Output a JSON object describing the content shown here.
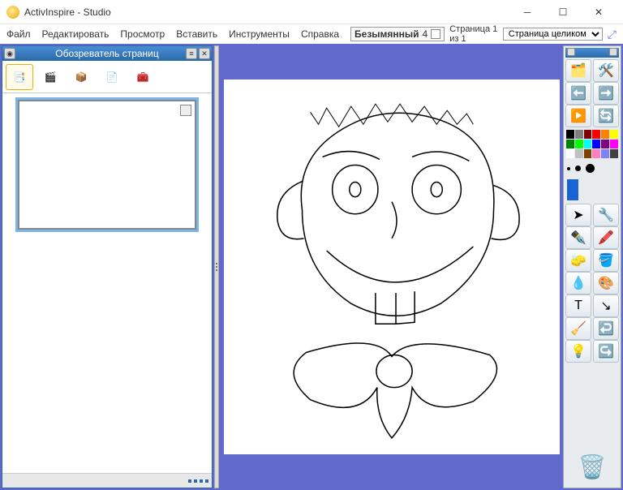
{
  "title": "ActivInspire - Studio",
  "menu": {
    "file": "Файл",
    "edit": "Редактировать",
    "view": "Просмотр",
    "insert": "Вставить",
    "tools": "Инструменты",
    "help": "Справка"
  },
  "doc": {
    "tab_label": "Безымянный",
    "tab_index": "4",
    "page_indicator": "Страница 1 из 1",
    "zoom": "Страница целиком"
  },
  "browser": {
    "title": "Обозреватель страниц",
    "tabs": [
      {
        "name": "pages",
        "icon": "📑"
      },
      {
        "name": "resources",
        "icon": "🎬"
      },
      {
        "name": "objects",
        "icon": "📦"
      },
      {
        "name": "notes",
        "icon": "📄"
      },
      {
        "name": "properties",
        "icon": "🧰"
      }
    ]
  },
  "palette": {
    "colors": [
      "#000000",
      "#808080",
      "#800000",
      "#ff0000",
      "#ff8000",
      "#ffff00",
      "#008000",
      "#00ff00",
      "#00ffff",
      "#0000ff",
      "#800080",
      "#ff00ff",
      "#ffffff",
      "#c0c0c0",
      "#804000",
      "#ff80c0",
      "#8080ff",
      "#404040"
    ]
  },
  "tools": {
    "row1": [
      {
        "name": "main-menu",
        "icon": "🗂️"
      },
      {
        "name": "settings",
        "icon": "🛠️"
      }
    ],
    "row2": [
      {
        "name": "prev-page",
        "icon": "⬅️"
      },
      {
        "name": "next-page",
        "icon": "➡️"
      }
    ],
    "row3": [
      {
        "name": "play",
        "icon": "▶️"
      },
      {
        "name": "reset",
        "icon": "🔄"
      }
    ],
    "row4": [
      {
        "name": "select",
        "icon": "➤"
      },
      {
        "name": "tools",
        "icon": "🔧"
      }
    ],
    "row5": [
      {
        "name": "pen",
        "icon": "✒️"
      },
      {
        "name": "highlighter",
        "icon": "🖍️"
      }
    ],
    "row6": [
      {
        "name": "eraser",
        "icon": "🧽"
      },
      {
        "name": "fill",
        "icon": "🪣"
      }
    ],
    "row7": [
      {
        "name": "picker",
        "icon": "💧"
      },
      {
        "name": "shapes",
        "icon": "🎨"
      }
    ],
    "row8": [
      {
        "name": "text",
        "icon": "T"
      },
      {
        "name": "connector",
        "icon": "↘"
      }
    ],
    "row9": [
      {
        "name": "clear",
        "icon": "🧹"
      },
      {
        "name": "undo",
        "icon": "↩️"
      }
    ],
    "row10": [
      {
        "name": "spotlight",
        "icon": "💡"
      },
      {
        "name": "redo",
        "icon": "↪️"
      }
    ]
  }
}
